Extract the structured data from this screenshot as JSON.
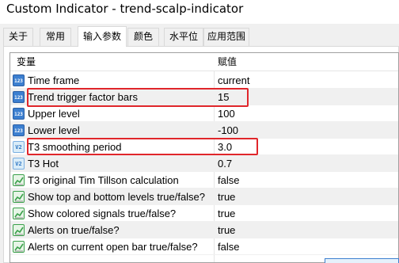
{
  "window": {
    "title": "Custom Indicator - trend-scalp-indicator"
  },
  "tabs": [
    {
      "label": "关于"
    },
    {
      "label": "常用"
    },
    {
      "label": "输入参数"
    },
    {
      "label": "颜色"
    },
    {
      "label": "水平位"
    },
    {
      "label": "应用范围"
    }
  ],
  "active_tab": "输入参数",
  "grid": {
    "headers": {
      "variable": "变量",
      "value": "赋值"
    },
    "rows": [
      {
        "name": "Time frame",
        "value": "current",
        "type_icon": "int-type-icon",
        "icon_text": "123"
      },
      {
        "name": "Trend trigger factor bars",
        "value": "15",
        "type_icon": "int-type-icon",
        "icon_text": "123"
      },
      {
        "name": "Upper level",
        "value": "100",
        "type_icon": "int-type-icon",
        "icon_text": "123"
      },
      {
        "name": "Lower level",
        "value": "-100",
        "type_icon": "int-type-icon",
        "icon_text": "123"
      },
      {
        "name": "T3 smoothing period",
        "value": "3.0",
        "type_icon": "double-type-icon",
        "icon_text": "V2"
      },
      {
        "name": "T3 Hot",
        "value": "0.7",
        "type_icon": "double-type-icon",
        "icon_text": "V2"
      },
      {
        "name": "T3 original Tim Tillson calculation",
        "value": "false",
        "type_icon": "bool-type-icon",
        "icon_text": ""
      },
      {
        "name": "Show top and bottom levels true/false?",
        "value": "true",
        "type_icon": "bool-type-icon",
        "icon_text": ""
      },
      {
        "name": "Show colored signals true/false?",
        "value": "true",
        "type_icon": "bool-type-icon",
        "icon_text": ""
      },
      {
        "name": "Alerts on true/false?",
        "value": "true",
        "type_icon": "bool-type-icon",
        "icon_text": ""
      },
      {
        "name": "Alerts on current open bar true/false?",
        "value": "false",
        "type_icon": "bool-type-icon",
        "icon_text": ""
      }
    ]
  },
  "colors": {
    "highlight": "#e0262b",
    "int_icon": "#3c7fd0",
    "bool_icon": "#3aa04a"
  }
}
